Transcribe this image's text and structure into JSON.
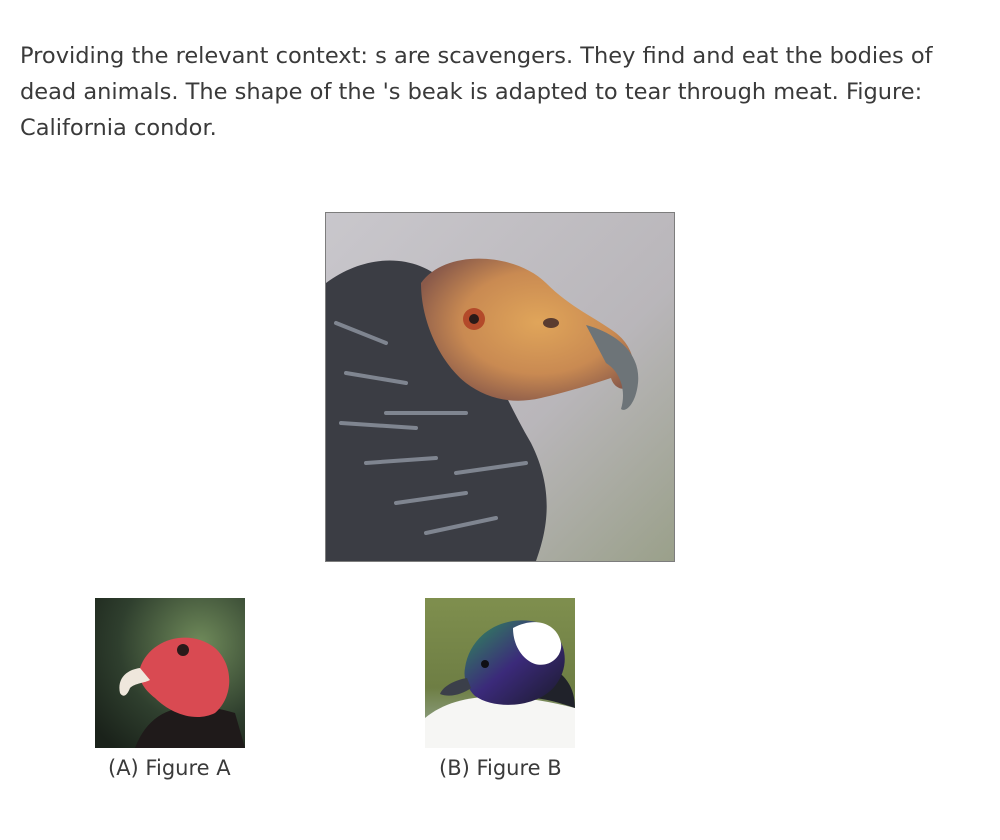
{
  "context": {
    "text": "Providing the relevant context: s are scavengers. They find and eat the bodies of dead animals. The shape of the 's beak is adapted to tear through meat. Figure: California condor."
  },
  "main_image": {
    "subject": "california-condor-head"
  },
  "options": [
    {
      "label": "(A) Figure A",
      "subject": "turkey-vulture-head"
    },
    {
      "label": "(B) Figure B",
      "subject": "bufflehead-duck-head"
    }
  ],
  "colors": {
    "text": "#3a3a3a",
    "image_border": "#7d7d7d"
  }
}
